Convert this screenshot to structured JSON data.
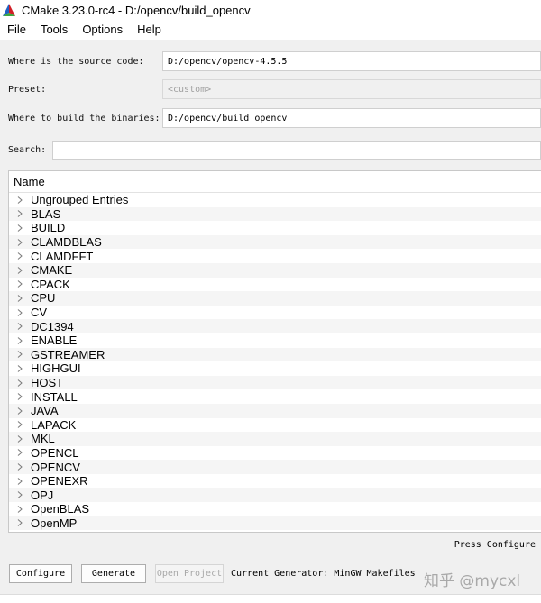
{
  "window": {
    "title": "CMake 3.23.0-rc4 - D:/opencv/build_opencv"
  },
  "menu": [
    "File",
    "Tools",
    "Options",
    "Help"
  ],
  "source": {
    "label": "Where is the source code:",
    "value": "D:/opencv/opencv-4.5.5"
  },
  "preset": {
    "label": "Preset:",
    "value": "<custom>"
  },
  "build": {
    "label": "Where to build the binaries:",
    "value": "D:/opencv/build_opencv"
  },
  "search": {
    "label": "Search:",
    "value": ""
  },
  "tree": {
    "header": "Name",
    "rows": [
      "Ungrouped Entries",
      "BLAS",
      "BUILD",
      "CLAMDBLAS",
      "CLAMDFFT",
      "CMAKE",
      "CPACK",
      "CPU",
      "CV",
      "DC1394",
      "ENABLE",
      "GSTREAMER",
      "HIGHGUI",
      "HOST",
      "INSTALL",
      "JAVA",
      "LAPACK",
      "MKL",
      "OPENCL",
      "OPENCV",
      "OPENEXR",
      "OPJ",
      "OpenBLAS",
      "OpenMP"
    ]
  },
  "status": {
    "hint": "Press Configure"
  },
  "buttons": {
    "configure": "Configure",
    "generate": "Generate",
    "open_project": "Open Project"
  },
  "generator": {
    "text": "Current Generator: MinGW Makefiles"
  },
  "watermark": "知乎 @mycxl"
}
